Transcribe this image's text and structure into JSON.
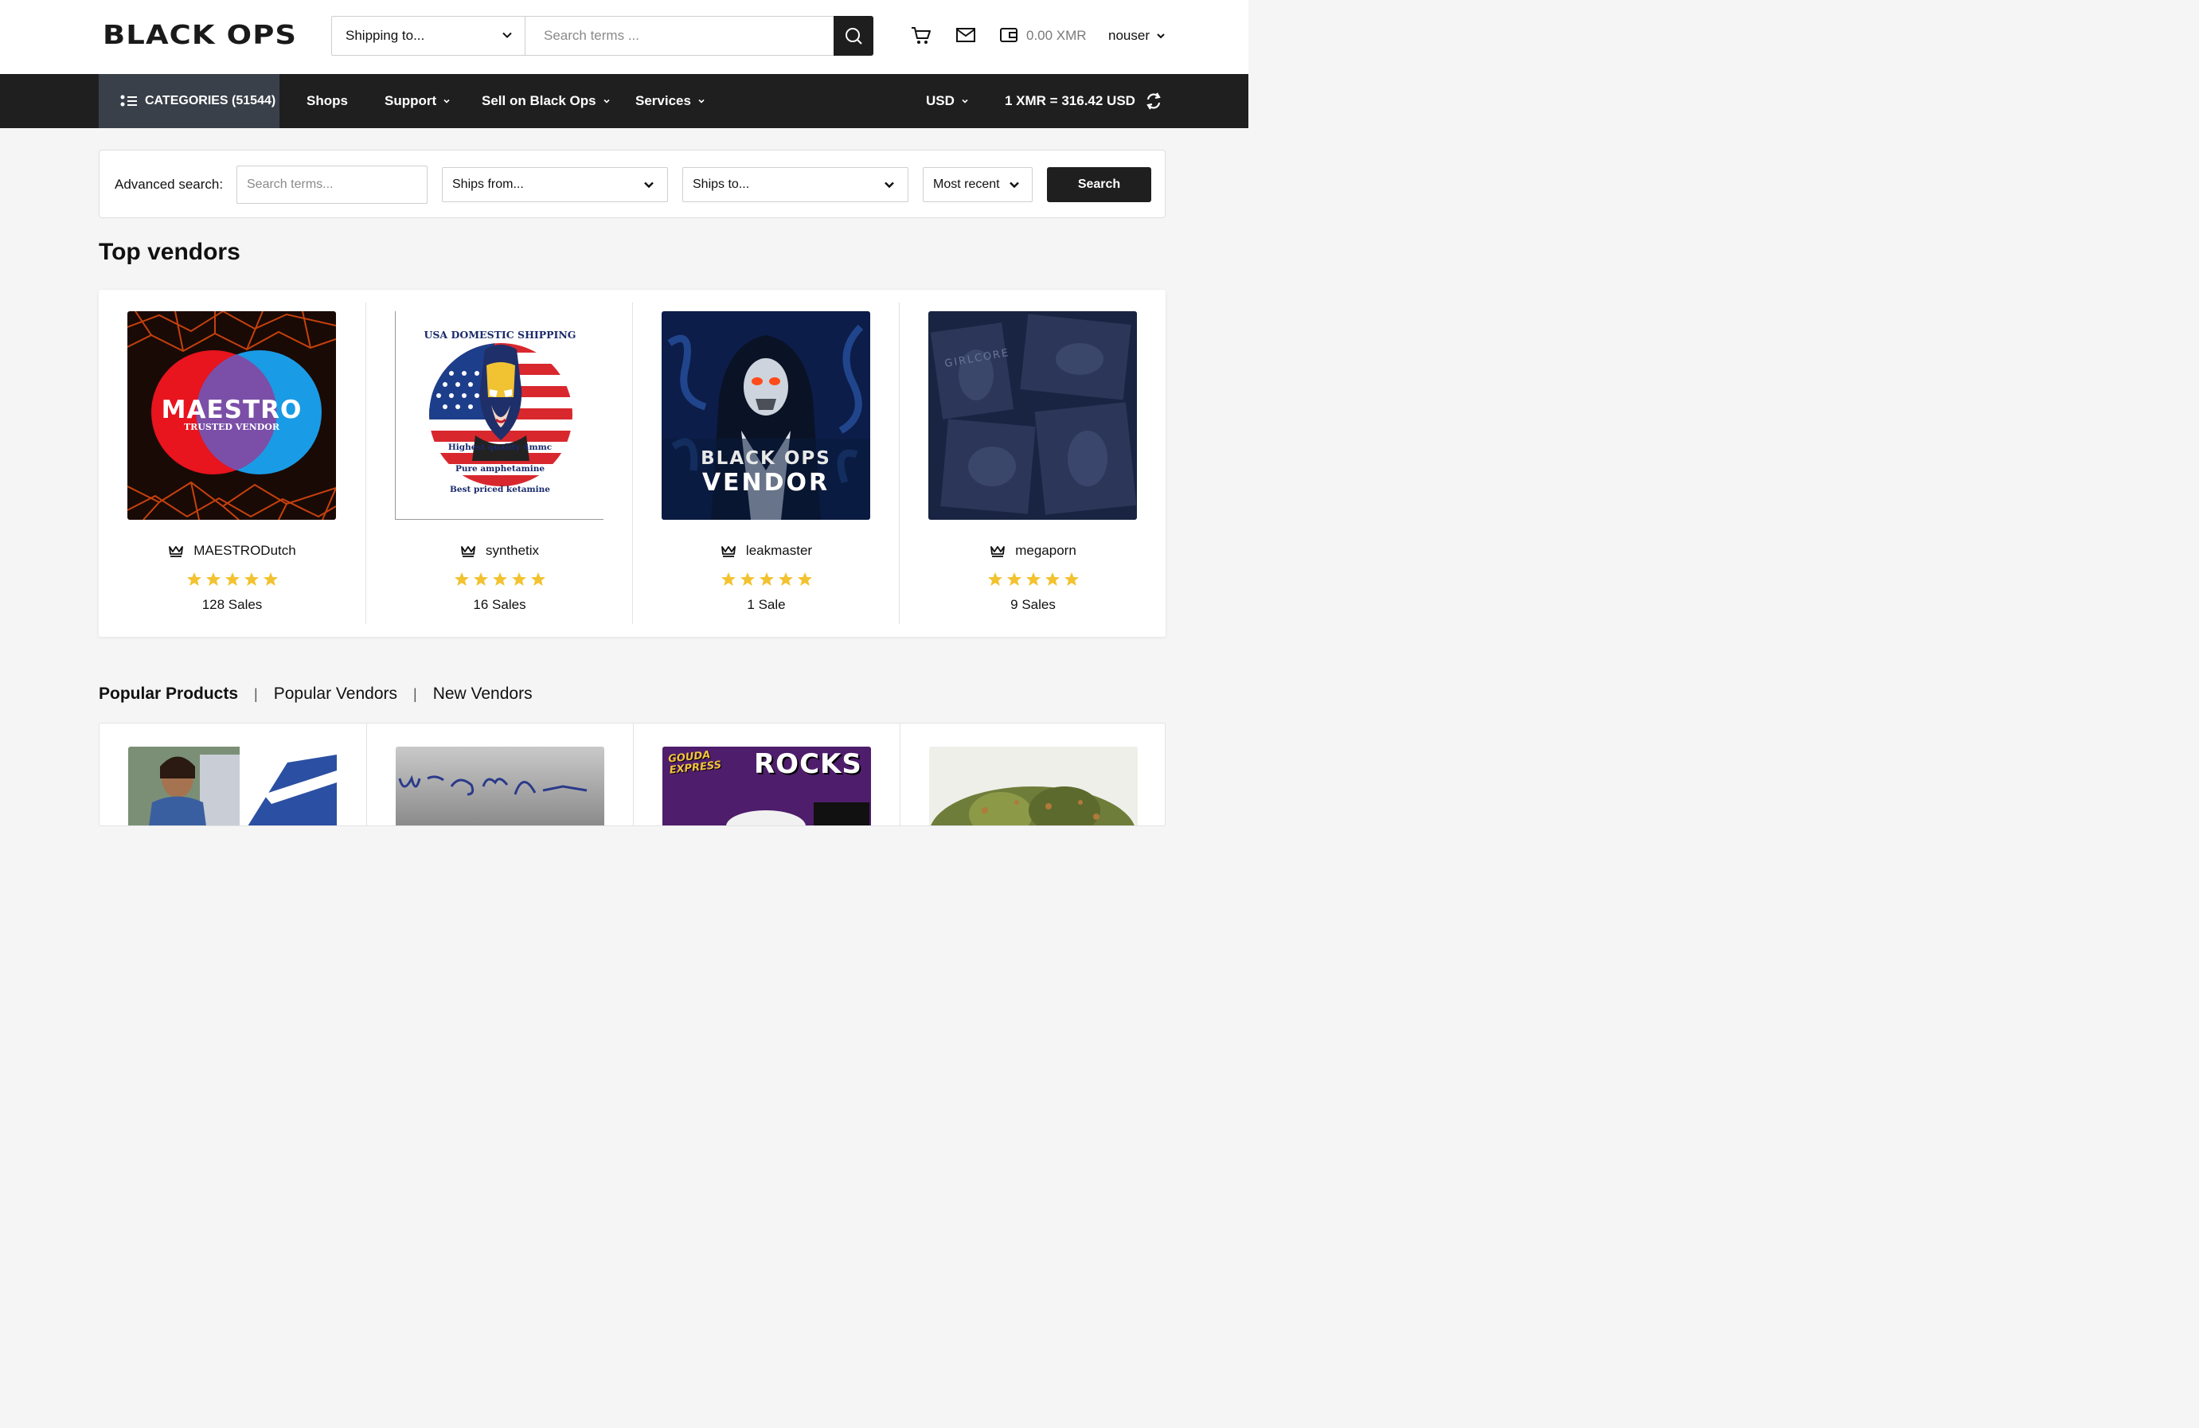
{
  "header": {
    "logo": "BLACK OPS",
    "shipping_select": "Shipping to...",
    "search_placeholder": "Search terms ...",
    "wallet_amount": "0.00 XMR",
    "username": "nouser"
  },
  "nav": {
    "categories": "CATEGORIES (51544)",
    "shops": "Shops",
    "support": "Support",
    "sell": "Sell on Black Ops",
    "services": "Services",
    "currency": "USD",
    "rate": "1 XMR = 316.42 USD"
  },
  "advanced_search": {
    "label": "Advanced search:",
    "placeholder": "Search terms...",
    "ships_from": "Ships from...",
    "ships_to": "Ships to...",
    "sort": "Most recent",
    "button": "Search"
  },
  "top_vendors": {
    "title": "Top vendors",
    "vendors": [
      {
        "name": "MAESTRODutch",
        "sales": "128 Sales",
        "rating": 5,
        "image_text": "MAESTRO",
        "image_subtext": "TRUSTED VENDOR"
      },
      {
        "name": "synthetix",
        "sales": "16 Sales",
        "rating": 5,
        "image_text": "USA DOMESTIC SHIPPING",
        "image_lines": [
          "Highest quality 4mmc",
          "Pure amphetamine",
          "Best priced ketamine"
        ]
      },
      {
        "name": "leakmaster",
        "sales": "1 Sale",
        "rating": 5,
        "image_text": "BLACK OPS",
        "image_subtext": "VENDOR"
      },
      {
        "name": "megaporn",
        "sales": "9 Sales",
        "rating": 5,
        "image_text": "GIRLCORE"
      }
    ]
  },
  "product_tabs": {
    "popular_products": "Popular Products",
    "popular_vendors": "Popular Vendors",
    "new_vendors": "New Vendors"
  },
  "product_images": {
    "third_badge": "GOUDA EXPRESS",
    "third_title": "ROCKS"
  },
  "colors": {
    "nav_bg": "#1f1f1f",
    "categories_bg": "#3a4049",
    "star": "#f2c230"
  }
}
